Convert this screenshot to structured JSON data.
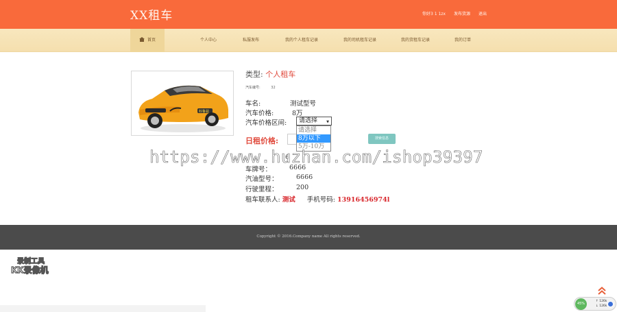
{
  "header": {
    "logo": "XX租车",
    "links": [
      "你好3 1 1zx",
      "发布货源",
      "退出"
    ]
  },
  "nav": {
    "items": [
      "首页",
      "个人中心",
      "私服发布",
      "我的个人租车记录",
      "我的司机租车记录",
      "我的货租车记录",
      "我的订单"
    ]
  },
  "detail": {
    "type_label": "类型:",
    "type_value": "个人租车",
    "car_no_label": "汽车编号:",
    "car_no_value": "32",
    "name_label": "车名:",
    "name_value": "测试型号",
    "price_label": "汽车价格:",
    "price_value": "8万",
    "range_label": "汽车价格区间:",
    "range_selected": "请选择",
    "range_options": [
      "请选择",
      "8万以下",
      "5万-10万"
    ],
    "range_highlighted_index": 1,
    "daily_label": "日租价格:",
    "search_label": "搜索信息",
    "seats_value": "6",
    "plate_label": "车牌号：",
    "plate_value": "6666",
    "fuel_label": "汽油型号：",
    "fuel_value": "6666",
    "mileage_label": "行驶里程：",
    "mileage_value": "200",
    "contact_label": "租车联系人:",
    "contact_value": "测试",
    "phone_label": "手机号码:",
    "phone_value": "13916456974l"
  },
  "watermark": "https://www.huzhan.com/ishop39397",
  "footer": {
    "copyright": "Copyright © 2016.Company name All rights reserved."
  },
  "badge": {
    "line1": "录制工具",
    "line2": "KK录像机"
  },
  "speed_widget": {
    "percent": "45%",
    "up": "126k",
    "down": "126k"
  },
  "colors": {
    "topbar": "#f96a3b",
    "navbar": "#f8e7be",
    "accent_red": "#e0483a",
    "footer": "#4b4b4b"
  }
}
